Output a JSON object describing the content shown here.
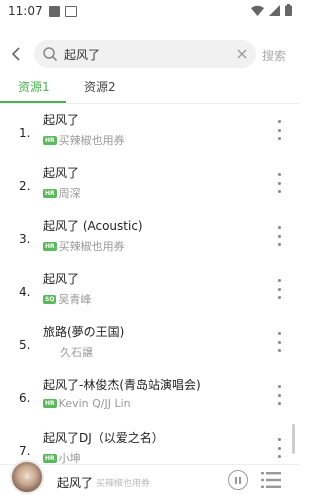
{
  "status": {
    "time": "11:07"
  },
  "search": {
    "query": "起风了",
    "button_label": "搜索"
  },
  "tabs": [
    {
      "label": "资源1",
      "active": true
    },
    {
      "label": "资源2",
      "active": false
    }
  ],
  "songs": [
    {
      "num": "1.",
      "title": "起风了",
      "badge": "HR",
      "artist": "买辣椒也用券"
    },
    {
      "num": "2.",
      "title": "起风了",
      "badge": "HR",
      "artist": "周深"
    },
    {
      "num": "3.",
      "title": "起风了 (Acoustic)",
      "badge": "HR",
      "artist": "买辣椒也用券"
    },
    {
      "num": "4.",
      "title": "起风了",
      "badge": "SQ",
      "artist": "吴青峰"
    },
    {
      "num": "5.",
      "title": "旅路(夢の王国)",
      "badge": "",
      "artist": "久石譲"
    },
    {
      "num": "6.",
      "title": "起风了-林俊杰(青岛站演唱会)",
      "badge": "HR",
      "artist": "Kevin Q/JJ Lin"
    },
    {
      "num": "7.",
      "title": "起风了DJ（以爱之名）",
      "badge": "HR",
      "artist": "小坤"
    }
  ],
  "player": {
    "title": "起风了",
    "artist": "买辣椒也用券"
  },
  "colors": {
    "accent": "#4caf50",
    "badge": "#5cb85c"
  },
  "icons": {
    "status": [
      "notification-square-icon",
      "image-icon",
      "wifi-icon",
      "signal-icon",
      "battery-icon"
    ],
    "header": [
      "back-arrow-icon",
      "search-icon",
      "clear-icon"
    ],
    "rows": "more-vertical-icon",
    "player": [
      "pause-icon",
      "playlist-icon"
    ]
  }
}
